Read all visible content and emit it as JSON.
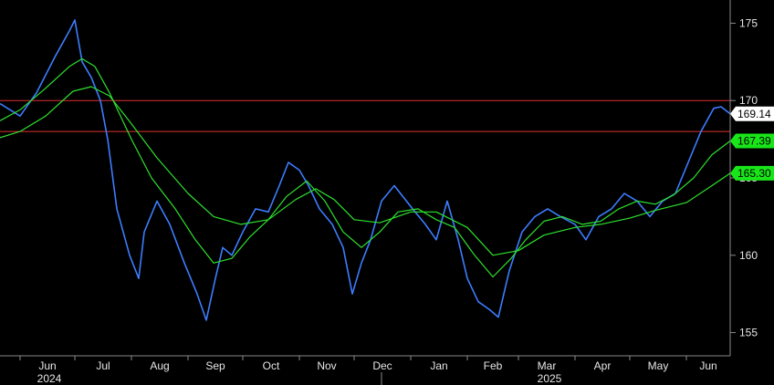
{
  "chart_data": {
    "type": "line",
    "title": "",
    "xlabel": "",
    "ylabel": "",
    "x_range": [
      "2024-05-21",
      "2025-06-25"
    ],
    "ylim": [
      153.5,
      176.5
    ],
    "y_ticks": [
      155,
      160,
      165,
      170,
      175
    ],
    "x_ticks": [
      {
        "label": "Jun",
        "date": "2024-06-01"
      },
      {
        "label": "Jul",
        "date": "2024-07-01"
      },
      {
        "label": "Aug",
        "date": "2024-08-01"
      },
      {
        "label": "Sep",
        "date": "2024-09-01"
      },
      {
        "label": "Oct",
        "date": "2024-10-01"
      },
      {
        "label": "Nov",
        "date": "2024-11-01"
      },
      {
        "label": "Dec",
        "date": "2024-12-01"
      },
      {
        "label": "Jan",
        "date": "2025-01-01"
      },
      {
        "label": "Feb",
        "date": "2025-02-01"
      },
      {
        "label": "Mar",
        "date": "2025-03-01"
      },
      {
        "label": "Apr",
        "date": "2025-04-01"
      },
      {
        "label": "May",
        "date": "2025-05-01"
      },
      {
        "label": "Jun",
        "date": "2025-06-01"
      }
    ],
    "years": [
      {
        "label": "2024",
        "date": "2024-07-01"
      },
      {
        "label": "2025",
        "date": "2025-04-01"
      }
    ],
    "year_dividers": [
      "2025-01-01"
    ],
    "horizontal_lines": [
      {
        "value": 170.0,
        "color": "#e03030"
      },
      {
        "value": 168.0,
        "color": "#e03030"
      }
    ],
    "price_tags": [
      {
        "label": "169.14",
        "value": 169.14,
        "bg": "#ffffff",
        "fg": "#000000"
      },
      {
        "label": "167.39",
        "value": 167.39,
        "bg": "#19e619",
        "fg": "#000000"
      },
      {
        "label": "165.30",
        "value": 165.3,
        "bg": "#19e619",
        "fg": "#000000"
      }
    ],
    "series": [
      {
        "color": "#3d7dff",
        "points": [
          [
            "2024-05-21",
            169.8
          ],
          [
            "2024-06-01",
            169.0
          ],
          [
            "2024-06-10",
            170.5
          ],
          [
            "2024-06-20",
            172.8
          ],
          [
            "2024-06-28",
            174.5
          ],
          [
            "2024-07-01",
            175.2
          ],
          [
            "2024-07-05",
            172.5
          ],
          [
            "2024-07-10",
            171.5
          ],
          [
            "2024-07-15",
            170.0
          ],
          [
            "2024-07-19",
            167.5
          ],
          [
            "2024-07-24",
            163.0
          ],
          [
            "2024-07-31",
            160.0
          ],
          [
            "2024-08-05",
            158.5
          ],
          [
            "2024-08-08",
            161.5
          ],
          [
            "2024-08-15",
            163.5
          ],
          [
            "2024-08-22",
            162.0
          ],
          [
            "2024-08-30",
            159.5
          ],
          [
            "2024-09-06",
            157.5
          ],
          [
            "2024-09-11",
            155.8
          ],
          [
            "2024-09-16",
            158.5
          ],
          [
            "2024-09-20",
            160.5
          ],
          [
            "2024-09-25",
            160.0
          ],
          [
            "2024-10-01",
            161.5
          ],
          [
            "2024-10-08",
            163.0
          ],
          [
            "2024-10-15",
            162.8
          ],
          [
            "2024-10-21",
            164.5
          ],
          [
            "2024-10-26",
            166.0
          ],
          [
            "2024-11-01",
            165.5
          ],
          [
            "2024-11-06",
            164.5
          ],
          [
            "2024-11-12",
            163.0
          ],
          [
            "2024-11-19",
            162.0
          ],
          [
            "2024-11-25",
            160.5
          ],
          [
            "2024-11-30",
            157.5
          ],
          [
            "2024-12-05",
            159.5
          ],
          [
            "2024-12-10",
            161.0
          ],
          [
            "2024-12-16",
            163.5
          ],
          [
            "2024-12-23",
            164.5
          ],
          [
            "2025-01-02",
            163.0
          ],
          [
            "2025-01-09",
            162.0
          ],
          [
            "2025-01-15",
            161.0
          ],
          [
            "2025-01-21",
            163.5
          ],
          [
            "2025-01-27",
            161.0
          ],
          [
            "2025-02-01",
            158.5
          ],
          [
            "2025-02-07",
            157.0
          ],
          [
            "2025-02-13",
            156.5
          ],
          [
            "2025-02-18",
            156.0
          ],
          [
            "2025-02-24",
            159.0
          ],
          [
            "2025-03-03",
            161.5
          ],
          [
            "2025-03-10",
            162.5
          ],
          [
            "2025-03-17",
            163.0
          ],
          [
            "2025-03-24",
            162.5
          ],
          [
            "2025-04-01",
            162.0
          ],
          [
            "2025-04-07",
            161.0
          ],
          [
            "2025-04-14",
            162.5
          ],
          [
            "2025-04-21",
            163.0
          ],
          [
            "2025-04-28",
            164.0
          ],
          [
            "2025-05-05",
            163.5
          ],
          [
            "2025-05-12",
            162.5
          ],
          [
            "2025-05-19",
            163.5
          ],
          [
            "2025-05-26",
            164.0
          ],
          [
            "2025-06-02",
            166.0
          ],
          [
            "2025-06-09",
            168.0
          ],
          [
            "2025-06-16",
            169.5
          ],
          [
            "2025-06-20",
            169.6
          ],
          [
            "2025-06-25",
            169.14
          ]
        ]
      },
      {
        "color": "#2ee02e",
        "points": [
          [
            "2024-05-21",
            168.7
          ],
          [
            "2024-06-01",
            169.4
          ],
          [
            "2024-06-15",
            170.8
          ],
          [
            "2024-06-28",
            172.2
          ],
          [
            "2024-07-05",
            172.7
          ],
          [
            "2024-07-12",
            172.2
          ],
          [
            "2024-07-20",
            170.5
          ],
          [
            "2024-08-01",
            167.5
          ],
          [
            "2024-08-12",
            165.0
          ],
          [
            "2024-08-25",
            163.0
          ],
          [
            "2024-09-05",
            161.0
          ],
          [
            "2024-09-15",
            159.5
          ],
          [
            "2024-09-25",
            159.8
          ],
          [
            "2024-10-05",
            161.2
          ],
          [
            "2024-10-15",
            162.3
          ],
          [
            "2024-10-25",
            163.8
          ],
          [
            "2024-11-05",
            164.8
          ],
          [
            "2024-11-15",
            163.5
          ],
          [
            "2024-11-25",
            161.5
          ],
          [
            "2024-12-05",
            160.5
          ],
          [
            "2024-12-15",
            161.5
          ],
          [
            "2024-12-25",
            162.8
          ],
          [
            "2025-01-05",
            163.0
          ],
          [
            "2025-01-15",
            162.3
          ],
          [
            "2025-01-25",
            161.8
          ],
          [
            "2025-02-05",
            160.0
          ],
          [
            "2025-02-15",
            158.6
          ],
          [
            "2025-02-25",
            159.8
          ],
          [
            "2025-03-05",
            161.0
          ],
          [
            "2025-03-15",
            162.2
          ],
          [
            "2025-03-25",
            162.5
          ],
          [
            "2025-04-05",
            162.0
          ],
          [
            "2025-04-15",
            162.2
          ],
          [
            "2025-04-25",
            163.0
          ],
          [
            "2025-05-05",
            163.5
          ],
          [
            "2025-05-15",
            163.3
          ],
          [
            "2025-05-25",
            163.9
          ],
          [
            "2025-06-05",
            165.0
          ],
          [
            "2025-06-15",
            166.5
          ],
          [
            "2025-06-25",
            167.39
          ]
        ]
      },
      {
        "color": "#2ee02e",
        "points": [
          [
            "2024-05-21",
            167.6
          ],
          [
            "2024-06-01",
            168.0
          ],
          [
            "2024-06-15",
            169.0
          ],
          [
            "2024-06-30",
            170.6
          ],
          [
            "2024-07-10",
            170.9
          ],
          [
            "2024-07-20",
            170.3
          ],
          [
            "2024-08-01",
            168.5
          ],
          [
            "2024-08-15",
            166.3
          ],
          [
            "2024-09-01",
            164.0
          ],
          [
            "2024-09-15",
            162.5
          ],
          [
            "2024-09-30",
            162.0
          ],
          [
            "2024-10-15",
            162.3
          ],
          [
            "2024-10-30",
            163.6
          ],
          [
            "2024-11-10",
            164.3
          ],
          [
            "2024-11-20",
            163.6
          ],
          [
            "2024-12-01",
            162.3
          ],
          [
            "2024-12-15",
            162.1
          ],
          [
            "2025-01-01",
            162.8
          ],
          [
            "2025-01-15",
            162.8
          ],
          [
            "2025-02-01",
            161.8
          ],
          [
            "2025-02-15",
            160.0
          ],
          [
            "2025-03-01",
            160.3
          ],
          [
            "2025-03-15",
            161.3
          ],
          [
            "2025-04-01",
            161.8
          ],
          [
            "2025-04-15",
            162.0
          ],
          [
            "2025-05-01",
            162.4
          ],
          [
            "2025-05-15",
            162.9
          ],
          [
            "2025-06-01",
            163.4
          ],
          [
            "2025-06-15",
            164.5
          ],
          [
            "2025-06-25",
            165.3
          ]
        ]
      }
    ]
  }
}
